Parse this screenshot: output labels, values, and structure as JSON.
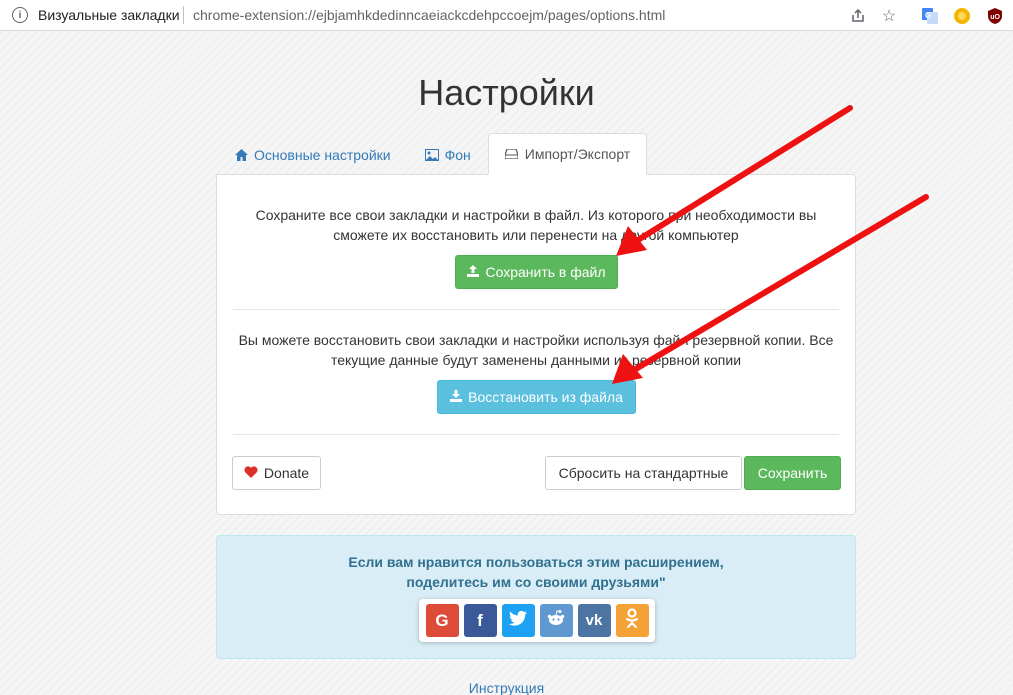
{
  "browser": {
    "site_name": "Визуальные закладки",
    "url": "chrome-extension://ejbjamhkdedinncaeiackcdehpccoejm/pages/options.html",
    "icons": [
      "info-icon",
      "share-icon",
      "star-icon",
      "translate-icon",
      "extension-icon",
      "ublock-icon"
    ]
  },
  "page": {
    "title": "Настройки"
  },
  "tabs": [
    {
      "label": "Основные настройки",
      "icon": "home-icon",
      "active": false
    },
    {
      "label": "Фон",
      "icon": "image-icon",
      "active": false
    },
    {
      "label": "Импорт/Экспорт",
      "icon": "hdd-icon",
      "active": true
    }
  ],
  "export": {
    "description": "Сохраните все свои закладки и настройки в файл. Из которого при необходимости вы сможете их восстановить или перенести на другой компьютер",
    "button_label": "Сохранить в файл"
  },
  "import": {
    "description": "Вы можете восстановить свои закладки и настройки используя файл резервной копии. Все текущие данные будут заменены данными из резервной копии",
    "button_label": "Восстановить из файла"
  },
  "actions": {
    "donate_label": "Donate",
    "reset_label": "Сбросить на стандартные",
    "save_label": "Сохранить"
  },
  "share": {
    "line1": "Если вам нравится пользоваться этим расширением,",
    "line2": "поделитесь им со своими друзьями\"",
    "networks": [
      {
        "name": "google",
        "glyph": "G",
        "color": "#dd4b39"
      },
      {
        "name": "facebook",
        "glyph": "f",
        "color": "#3b5998"
      },
      {
        "name": "twitter",
        "glyph": "t",
        "color": "#1da1f2"
      },
      {
        "name": "reddit",
        "glyph": "r",
        "color": "#5f99cf"
      },
      {
        "name": "vk",
        "glyph": "vk",
        "color": "#4c75a3"
      },
      {
        "name": "odnoklassniki",
        "glyph": "ok",
        "color": "#f4a236"
      }
    ]
  },
  "footer": {
    "link_label": "Инструкция"
  },
  "colors": {
    "annotation_arrow": "#ee1111",
    "primary_link": "#337ab7",
    "success": "#5cb85c",
    "info": "#5bc0de"
  }
}
